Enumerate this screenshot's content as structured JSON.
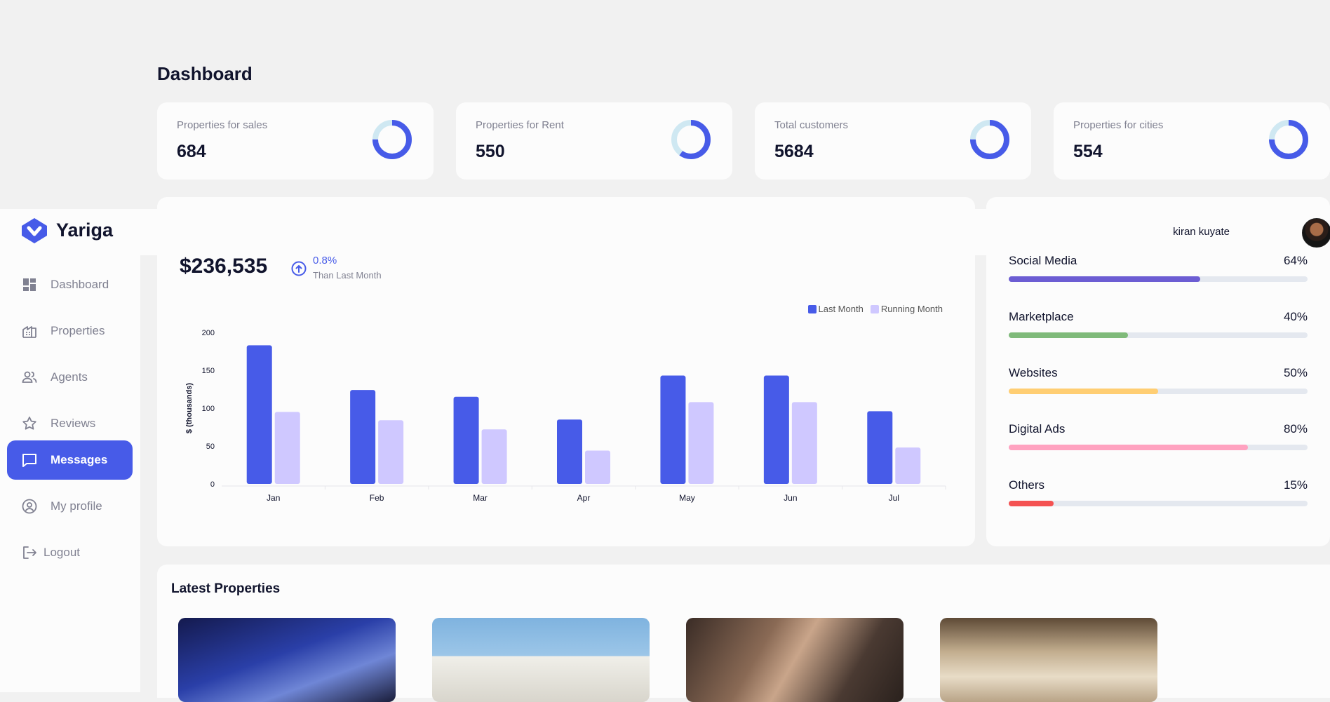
{
  "page": {
    "title": "Dashboard"
  },
  "brand": {
    "name": "Yariga"
  },
  "user": {
    "name": "kiran kuyate"
  },
  "stats": [
    {
      "label": "Properties for sales",
      "value": "684",
      "ring_fraction": 0.75
    },
    {
      "label": "Properties for Rent",
      "value": "550",
      "ring_fraction": 0.6
    },
    {
      "label": "Total customers",
      "value": "5684",
      "ring_fraction": 0.75
    },
    {
      "label": "Properties for cities",
      "value": "554",
      "ring_fraction": 0.75
    }
  ],
  "revenue": {
    "amount": "$236,535",
    "change": "0.8%",
    "change_note": "Than Last Month"
  },
  "chart_data": {
    "type": "bar",
    "categories": [
      "Jan",
      "Feb",
      "Mar",
      "Apr",
      "May",
      "Jun",
      "Jul"
    ],
    "series": [
      {
        "name": "Last Month",
        "values": [
          183,
          124,
          115,
          85,
          143,
          143,
          96
        ],
        "color": "#475be8"
      },
      {
        "name": "Running Month",
        "values": [
          95,
          84,
          72,
          44,
          108,
          108,
          48
        ],
        "color": "#cfc8ff"
      }
    ],
    "ylabel": "$ (thousands)",
    "ylim": [
      0,
      200
    ],
    "yticks": [
      "0",
      "50",
      "100",
      "150",
      "200"
    ],
    "legend_position": "top-right",
    "grid": false
  },
  "referrals": [
    {
      "label": "Social Media",
      "value": "64%",
      "fraction": 0.64,
      "color": "#6c5dd3"
    },
    {
      "label": "Marketplace",
      "value": "40%",
      "fraction": 0.4,
      "color": "#7fba7a"
    },
    {
      "label": "Websites",
      "value": "50%",
      "fraction": 0.5,
      "color": "#ffce73"
    },
    {
      "label": "Digital Ads",
      "value": "80%",
      "fraction": 0.8,
      "color": "#ffa2c0"
    },
    {
      "label": "Others",
      "value": "15%",
      "fraction": 0.15,
      "color": "#f45252"
    }
  ],
  "latest": {
    "title": "Latest Properties"
  },
  "sidebar": {
    "items": [
      {
        "label": "Dashboard",
        "icon": "dashboard-icon",
        "active": false
      },
      {
        "label": "Properties",
        "icon": "properties-icon",
        "active": false
      },
      {
        "label": "Agents",
        "icon": "agents-icon",
        "active": false
      },
      {
        "label": "Reviews",
        "icon": "star-icon",
        "active": false
      },
      {
        "label": "Messages",
        "icon": "messages-icon",
        "active": true
      },
      {
        "label": "My profile",
        "icon": "profile-icon",
        "active": false
      },
      {
        "label": "Logout",
        "icon": "logout-icon",
        "active": false
      }
    ]
  },
  "colors": {
    "accent": "#475be8",
    "ring_track": "#cfe8f2",
    "text": "#11142d",
    "muted": "#808191"
  }
}
